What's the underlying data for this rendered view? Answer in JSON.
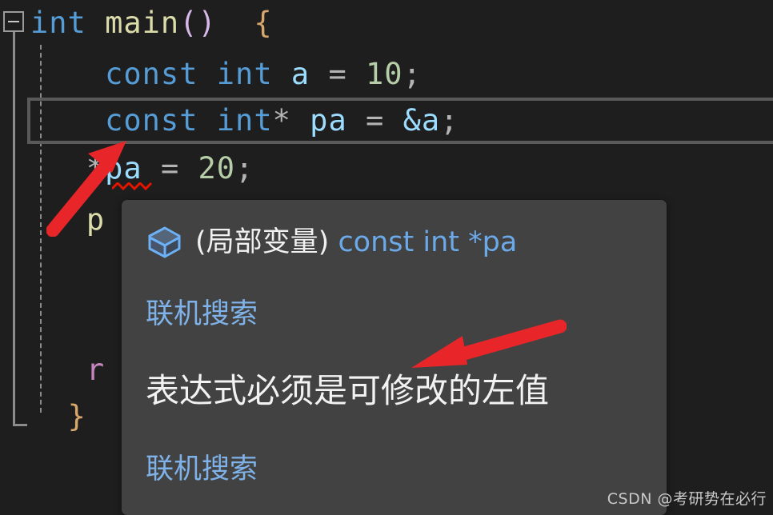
{
  "editor": {
    "background_color": "#1e1e1e",
    "fold_marker": "collapse-minus",
    "code_lines": [
      {
        "id": "line-1",
        "text": "int main() {",
        "tokens": [
          "int",
          "main",
          "()",
          "{"
        ]
      },
      {
        "id": "line-2",
        "text": "    const int a = 10;",
        "tokens": [
          "const",
          "int",
          "a",
          "=",
          "10",
          ";"
        ]
      },
      {
        "id": "line-3",
        "text": "    const int* pa = &a;",
        "tokens": [
          "const",
          "int",
          "*",
          "pa",
          "=",
          "&a",
          ";"
        ]
      },
      {
        "id": "line-4",
        "text": "    *pa = 20;",
        "tokens": [
          "*",
          "pa",
          "=",
          "20",
          ";"
        ]
      },
      {
        "id": "line-5",
        "text": "    p",
        "tokens": [
          "p"
        ]
      },
      {
        "id": "line-6",
        "text": "    r",
        "tokens": [
          "r"
        ]
      },
      {
        "id": "line-7",
        "text": "}",
        "tokens": [
          "}"
        ]
      }
    ],
    "line1": {
      "kw": "int",
      "fn": "main",
      "paren": "()",
      "brace": "{"
    },
    "line2": {
      "kw1": "const",
      "kw2": "int",
      "var": "a",
      "op": "=",
      "num": "10",
      "semi": ";"
    },
    "line3": {
      "kw1": "const",
      "kw2": "int",
      "star": "*",
      "var": "pa",
      "op": "=",
      "amp": "&a",
      "semi": ";"
    },
    "line4": {
      "star": "*",
      "var": "pa",
      "op": "=",
      "num": "20",
      "semi": ";"
    },
    "line5": {
      "partial": "p"
    },
    "line6": {
      "partial": "r"
    },
    "line7": {
      "brace": "}"
    },
    "highlighted_line": "const int* pa = &a;",
    "error_underline": "*pa",
    "colors": {
      "keyword": "#569cd6",
      "function": "#dcdcaa",
      "variable": "#9cdcfe",
      "number": "#b5cea8",
      "operator": "#b4b4b4",
      "brace": "#d7a76c",
      "paren": "#d8b8e8",
      "control": "#c586c0",
      "error_squiggle": "#e51400",
      "highlight_border": "#5a5a5a"
    }
  },
  "tooltip": {
    "background_color": "#424242",
    "icon": "local-variable-cube-icon",
    "signature_scope": "(局部变量) ",
    "signature_type": "const int *pa",
    "online_search_link_1": "联机搜索",
    "error_message": "表达式必须是可修改的左值",
    "online_search_link_2": "联机搜索",
    "link_color": "#7fb2e8",
    "type_color": "#6ca9e8"
  },
  "annotations": {
    "arrow_color": "#e8262a",
    "arrow_1_target": "const int* pa = &a;",
    "arrow_2_target": "表达式必须是可修改的左值"
  },
  "watermark": {
    "text": "CSDN @考研势在必行"
  }
}
